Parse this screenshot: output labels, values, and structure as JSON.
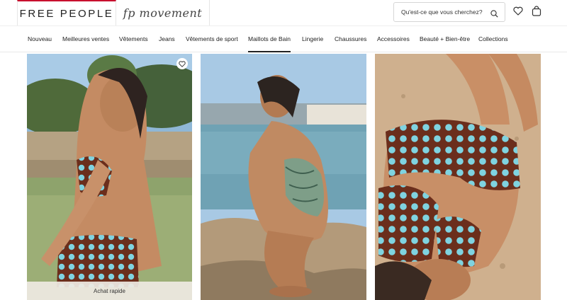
{
  "header": {
    "brand": "FREE PEOPLE",
    "sub_brand": "fp movement",
    "search": {
      "placeholder": "Qu'est-ce que vous cherchez?"
    }
  },
  "icons": {
    "search": "search-icon",
    "wishlist": "heart-icon",
    "bag": "shopping-bag-icon"
  },
  "nav": {
    "items": [
      "Nouveau",
      "Meilleures ventes",
      "Vêtements",
      "Jeans",
      "Vêtements de sport",
      "Maillots de Bain",
      "Lingerie",
      "Chaussures",
      "Accessoires",
      "Beauté + Bien-être",
      "Collections"
    ],
    "active": "Maillots de Bain"
  },
  "products": [
    {
      "quick_add_label": "Achat rapide"
    },
    {},
    {}
  ],
  "colors": {
    "accent_red": "#c8102e",
    "swim_brown": "#6b2e1c",
    "swim_dot": "#7fd3e0",
    "sand": "#cfb08e"
  }
}
